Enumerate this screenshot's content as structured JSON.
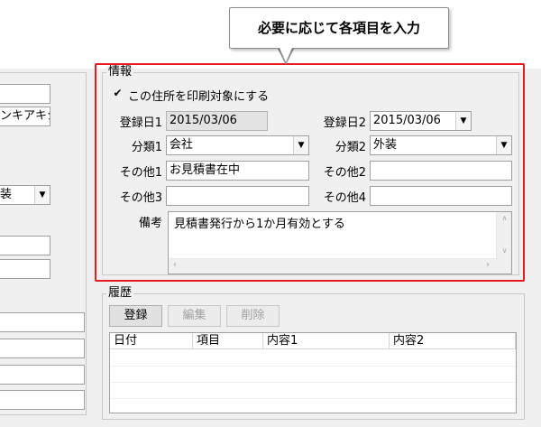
{
  "callout": {
    "text": "必要に応じて各項目を入力"
  },
  "left_panel": {
    "field2_value": "ンキアキシ",
    "combo_value": "装"
  },
  "info": {
    "legend": "情報",
    "print_check_label": "この住所を印刷対象にする",
    "print_checked": true,
    "reg_date1_label": "登録日1",
    "reg_date1_value": "2015/03/06",
    "reg_date2_label": "登録日2",
    "reg_date2_value": "2015/03/06",
    "cat1_label": "分類1",
    "cat1_value": "会社",
    "cat2_label": "分類2",
    "cat2_value": "外装",
    "other1_label": "その他1",
    "other1_value": "お見積書在中",
    "other2_label": "その他2",
    "other2_value": "",
    "other3_label": "その他3",
    "other3_value": "",
    "other4_label": "その他4",
    "other4_value": "",
    "memo_label": "備考",
    "memo_value": "見積書発行から1か月有効とする"
  },
  "history": {
    "legend": "履歴",
    "buttons": {
      "register": "登録",
      "edit": "編集",
      "delete": "削除"
    },
    "columns": [
      "日付",
      "項目",
      "内容1",
      "内容2"
    ]
  },
  "icons": {
    "dropdown": "dropdown-arrow-icon",
    "check": "checkmark-icon",
    "scroll_up": "scroll-up-arrow-icon",
    "scroll_down": "scroll-down-arrow-icon",
    "scroll_left": "scroll-left-arrow-icon",
    "scroll_right": "scroll-right-arrow-icon"
  },
  "colors": {
    "highlight": "#e8191c",
    "window": "#f0f0f0"
  }
}
